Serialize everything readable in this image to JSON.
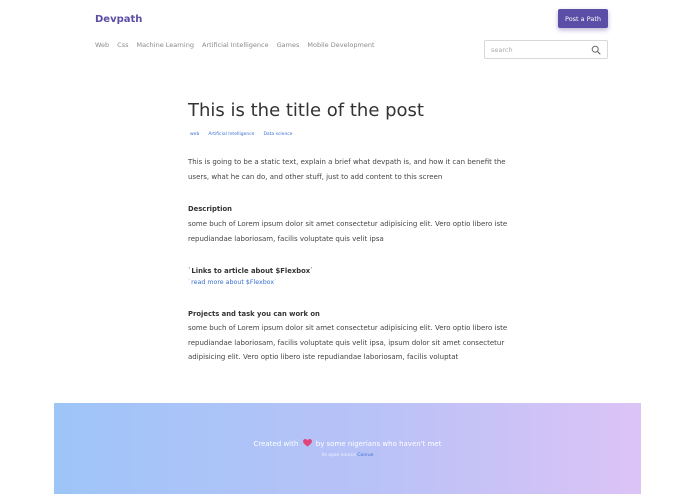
{
  "header": {
    "brand": "Devpath",
    "post_button": "Post a Path",
    "nav": [
      "Web",
      "Css",
      "Machine Learning",
      "Artificial Intelligence",
      "Games",
      "Mobile Development"
    ],
    "search_placeholder": "search"
  },
  "post": {
    "title": "This is the title of the post",
    "tags": [
      "web",
      "Artificial Intelligence",
      "Data science"
    ],
    "intro": "This is going to be a static text, explain a brief what devpath is, and how it can benefit the users, what he can do, and other stuff, just to add content to this screen",
    "description_heading": "Description",
    "description": "some buch of Lorem ipsum dolor sit amet consectetur adipisicing elit. Vero optio libero iste repudiandae laboriosam, facilis voluptate quis velit ipsa",
    "links_heading_prefix": "`",
    "links_heading": "Links to article about $Flexbox",
    "links_heading_suffix": "`",
    "link_tick_left": "`",
    "link_text": "read more about $Flexbox",
    "link_tick_right": "`",
    "projects_heading": "Projects and task you can work on",
    "projects": "some buch of Lorem ipsum dolor sit amet consectetur adipisicing elit. Vero optio libero iste repudiandae laboriosam, facilis voluptate quis velit ipsa, ipsum dolor sit amet consectetur adipisicing elit. Vero optio libero iste repudiandae laboriosam, facilis voluptat"
  },
  "footer": {
    "created_with": "Created with",
    "by_text": "by some nigerians who haven't met",
    "open_source_text": "its open source",
    "contribute_link": "Conrue",
    "heart_color": "#e0457b"
  }
}
